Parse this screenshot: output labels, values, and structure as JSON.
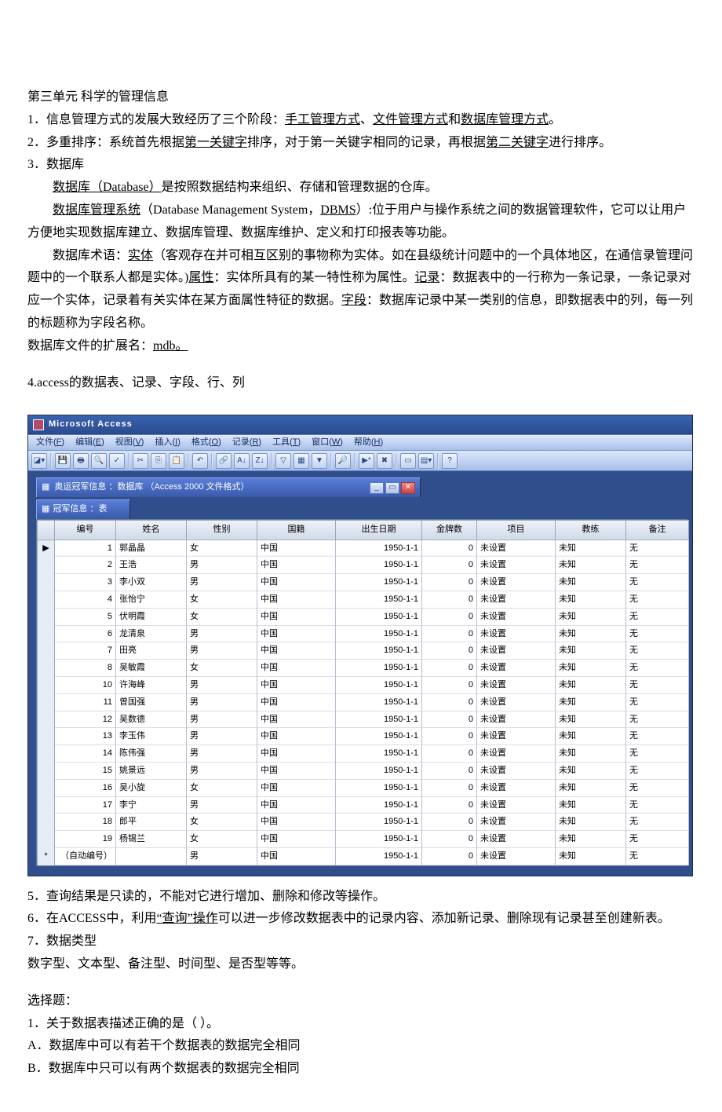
{
  "doc": {
    "title": "第三单元 科学的管理信息",
    "p1_a": "1．信息管理方式的发展大致经历了三个阶段：",
    "p1_u1": "手工管理方式",
    "p1_sep1": "、",
    "p1_u2": "文件管理方式",
    "p1_mid": "和",
    "p1_u3": "数据库管理方式",
    "p1_end": "。",
    "p2_a": "2．多重排序：系统首先根据",
    "p2_u1": "第一关键字",
    "p2_b": "排序，对于第一关键字相同的记录，再根据",
    "p2_u2": "第二关键字",
    "p2_c": "进行排序。",
    "p3": "3．数据库",
    "p3a_a": "数据库（Database）",
    "p3a_b": "是按照数据结构来组织、存储和管理数据的仓库。",
    "p3b_a": "数据库管理系统",
    "p3b_b": "（Database Management System，",
    "p3b_u": "DBMS",
    "p3b_c": "）:位于用户与操作系统之间的数据管理软件，它可以让用户方便地实现数据库建立、数据库管理、数据库维护、定义和打印报表等功能。",
    "p3c_a": "数据库术语：",
    "p3c_u1": "实体",
    "p3c_b": "（客观存在并可相互区别的事物称为实体。如在县级统计问题中的一个具体地区，在通信录管理问题中的一个联系人都是实体。)",
    "p3c_u2": "属性",
    "p3c_c": "：实体所具有的某一特性称为属性。",
    "p3c_u3": "记录",
    "p3c_d": "：数据表中的一行称为一条记录，一条记录对应一个实体，记录着有关实体在某方面属性特征的数据。",
    "p3c_u4": "字段",
    "p3c_e": "：数据库记录中某一类别的信息，即数据表中的列，每一列的标题称为字段名称。",
    "p3d_a": "数据库文件的扩展名：",
    "p3d_u": "mdb。",
    "p4": "4.access的数据表、记录、字段、行、列",
    "p5": "5．查询结果是只读的，不能对它进行增加、删除和修改等操作。",
    "p6_a": "6．在ACCESS中，利用",
    "p6_u": "“查询”操作",
    "p6_b": "可以进一步修改数据表中的记录内容、添加新记录、删除现有记录甚至创建新表。",
    "p7": "7．数据类型",
    "p7a": "数字型、文本型、备注型、时间型、是否型等等。",
    "q_head": "选择题：",
    "q1": "1．关于数据表描述正确的是（ ）。",
    "q1a": " A．数据库中可以有若干个数据表的数据完全相同",
    "q1b": " B．数据库中只可以有两个数据表的数据完全相同"
  },
  "access": {
    "app_title": "Microsoft Access",
    "menus": [
      {
        "label": "文件",
        "key": "F"
      },
      {
        "label": "编辑",
        "key": "E"
      },
      {
        "label": "视图",
        "key": "V"
      },
      {
        "label": "插入",
        "key": "I"
      },
      {
        "label": "格式",
        "key": "O"
      },
      {
        "label": "记录",
        "key": "R"
      },
      {
        "label": "工具",
        "key": "T"
      },
      {
        "label": "窗口",
        "key": "W"
      },
      {
        "label": "帮助",
        "key": "H"
      }
    ],
    "db_window_title": "奥运冠军信息 ：数据库 （Access 2000 文件格式）",
    "table_window_title": "冠军信息 ：表",
    "columns": [
      "编号",
      "姓名",
      "性别",
      "国籍",
      "出生日期",
      "金牌数",
      "项目",
      "教练",
      "备注"
    ],
    "rows": [
      {
        "id": "1",
        "name": "郭晶晶",
        "sex": "女",
        "nat": "中国",
        "dob": "1950-1-1",
        "gold": "0",
        "proj": "未设置",
        "coach": "未知",
        "note": "无",
        "sel": "▶"
      },
      {
        "id": "2",
        "name": "王浩",
        "sex": "男",
        "nat": "中国",
        "dob": "1950-1-1",
        "gold": "0",
        "proj": "未设置",
        "coach": "未知",
        "note": "无"
      },
      {
        "id": "3",
        "name": "李小双",
        "sex": "男",
        "nat": "中国",
        "dob": "1950-1-1",
        "gold": "0",
        "proj": "未设置",
        "coach": "未知",
        "note": "无"
      },
      {
        "id": "4",
        "name": "张怡宁",
        "sex": "女",
        "nat": "中国",
        "dob": "1950-1-1",
        "gold": "0",
        "proj": "未设置",
        "coach": "未知",
        "note": "无"
      },
      {
        "id": "5",
        "name": "伏明霞",
        "sex": "女",
        "nat": "中国",
        "dob": "1950-1-1",
        "gold": "0",
        "proj": "未设置",
        "coach": "未知",
        "note": "无"
      },
      {
        "id": "6",
        "name": "龙清泉",
        "sex": "男",
        "nat": "中国",
        "dob": "1950-1-1",
        "gold": "0",
        "proj": "未设置",
        "coach": "未知",
        "note": "无"
      },
      {
        "id": "7",
        "name": "田亮",
        "sex": "男",
        "nat": "中国",
        "dob": "1950-1-1",
        "gold": "0",
        "proj": "未设置",
        "coach": "未知",
        "note": "无"
      },
      {
        "id": "8",
        "name": "吴敏霞",
        "sex": "女",
        "nat": "中国",
        "dob": "1950-1-1",
        "gold": "0",
        "proj": "未设置",
        "coach": "未知",
        "note": "无"
      },
      {
        "id": "10",
        "name": "许海峰",
        "sex": "男",
        "nat": "中国",
        "dob": "1950-1-1",
        "gold": "0",
        "proj": "未设置",
        "coach": "未知",
        "note": "无"
      },
      {
        "id": "11",
        "name": "曾国强",
        "sex": "男",
        "nat": "中国",
        "dob": "1950-1-1",
        "gold": "0",
        "proj": "未设置",
        "coach": "未知",
        "note": "无"
      },
      {
        "id": "12",
        "name": "吴数德",
        "sex": "男",
        "nat": "中国",
        "dob": "1950-1-1",
        "gold": "0",
        "proj": "未设置",
        "coach": "未知",
        "note": "无"
      },
      {
        "id": "13",
        "name": "李玉伟",
        "sex": "男",
        "nat": "中国",
        "dob": "1950-1-1",
        "gold": "0",
        "proj": "未设置",
        "coach": "未知",
        "note": "无"
      },
      {
        "id": "14",
        "name": "陈伟强",
        "sex": "男",
        "nat": "中国",
        "dob": "1950-1-1",
        "gold": "0",
        "proj": "未设置",
        "coach": "未知",
        "note": "无"
      },
      {
        "id": "15",
        "name": "姚景远",
        "sex": "男",
        "nat": "中国",
        "dob": "1950-1-1",
        "gold": "0",
        "proj": "未设置",
        "coach": "未知",
        "note": "无"
      },
      {
        "id": "16",
        "name": "吴小旋",
        "sex": "女",
        "nat": "中国",
        "dob": "1950-1-1",
        "gold": "0",
        "proj": "未设置",
        "coach": "未知",
        "note": "无"
      },
      {
        "id": "17",
        "name": "李宁",
        "sex": "男",
        "nat": "中国",
        "dob": "1950-1-1",
        "gold": "0",
        "proj": "未设置",
        "coach": "未知",
        "note": "无"
      },
      {
        "id": "18",
        "name": "郎平",
        "sex": "女",
        "nat": "中国",
        "dob": "1950-1-1",
        "gold": "0",
        "proj": "未设置",
        "coach": "未知",
        "note": "无"
      },
      {
        "id": "19",
        "name": "杨锡兰",
        "sex": "女",
        "nat": "中国",
        "dob": "1950-1-1",
        "gold": "0",
        "proj": "未设置",
        "coach": "未知",
        "note": "无"
      },
      {
        "id": "（自动编号）",
        "name": "",
        "sex": "男",
        "nat": "中国",
        "dob": "1950-1-1",
        "gold": "0",
        "proj": "未设置",
        "coach": "未知",
        "note": "无",
        "sel": "*"
      }
    ]
  }
}
